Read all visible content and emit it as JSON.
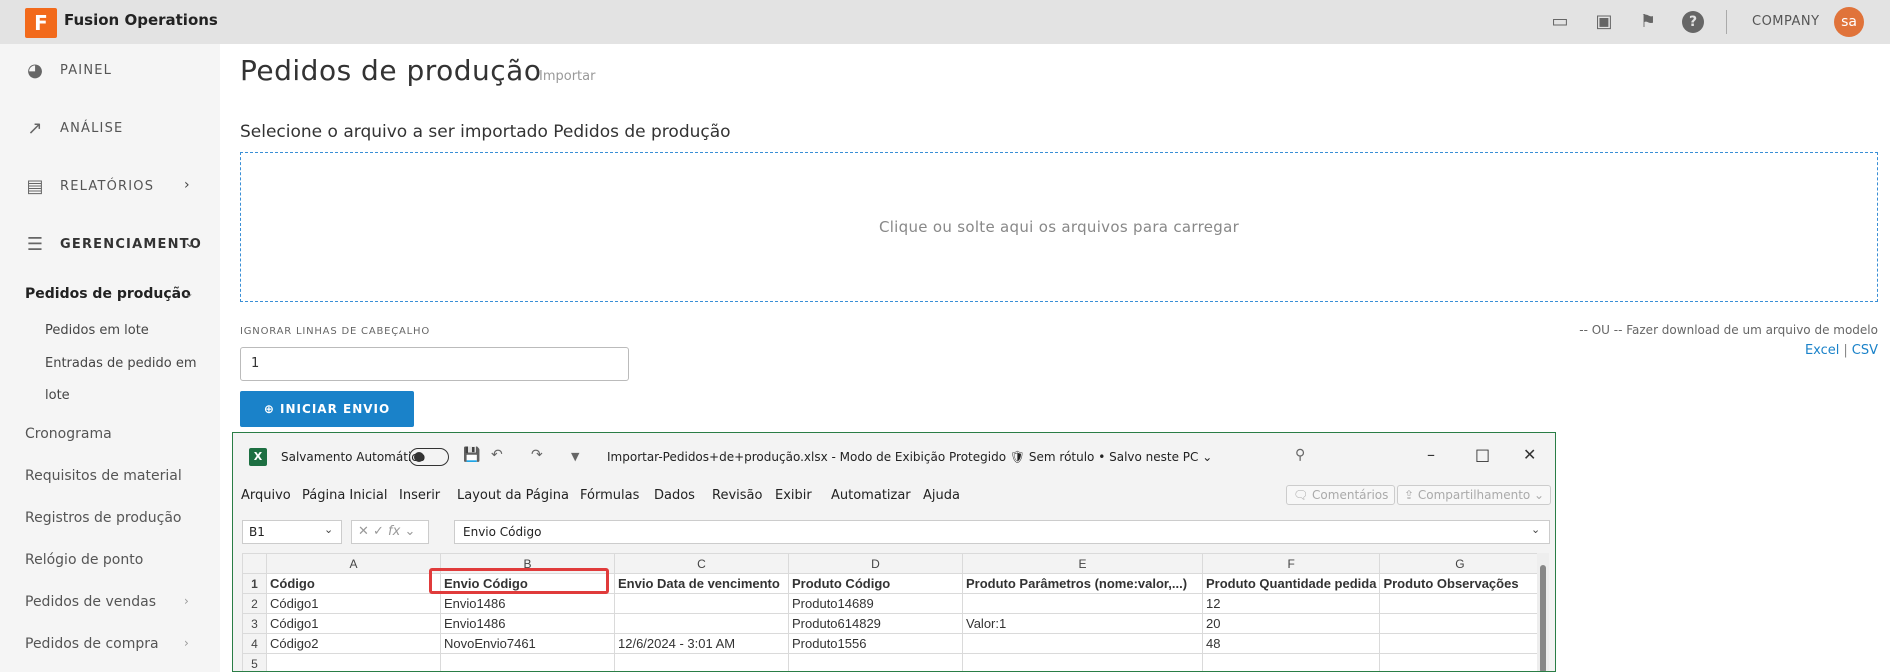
{
  "app": {
    "logo_letter": "F",
    "title": "Fusion Operations",
    "company": "COMPANY",
    "avatar": "sa"
  },
  "topbar_icons": [
    "chat-icon",
    "video-icon",
    "bookmark-icon",
    "help-icon"
  ],
  "sidebar": {
    "main": [
      {
        "label": "PAINEL",
        "icon": "gauge-icon"
      },
      {
        "label": "ANÁLISE",
        "icon": "analytics-icon"
      },
      {
        "label": "RELATÓRIOS",
        "icon": "reports-icon",
        "chevron": "›"
      },
      {
        "label": "GERENCIAMENTO",
        "icon": "sliders-icon",
        "chevron": "⌄"
      }
    ],
    "active": "Pedidos de produção",
    "active_chevron": "⌄",
    "sub": [
      "Pedidos em lote",
      "Entradas de pedido em",
      "lote"
    ],
    "sections": [
      {
        "label": "Cronograma"
      },
      {
        "label": "Requisitos de material"
      },
      {
        "label": "Registros de produção"
      },
      {
        "label": "Relógio de ponto"
      },
      {
        "label": "Pedidos de vendas",
        "chevron": "›"
      },
      {
        "label": "Pedidos de compra",
        "chevron": "›"
      }
    ]
  },
  "main": {
    "title": "Pedidos de produção",
    "subtitle": "Importar",
    "select_label": "Selecione o arquivo a ser importado Pedidos de produção",
    "dropzone_text": "Clique ou solte aqui os arquivos para carregar",
    "ignore_label": "IGNORAR LINHAS DE CABEÇALHO",
    "ignore_value": "1",
    "template_text": "-- OU -- Fazer download de um arquivo de modelo",
    "template_excel": "Excel",
    "template_sep": "|",
    "template_csv": "CSV",
    "start_button": "⊕ INICIAR ENVIO"
  },
  "excel": {
    "autosave_label": "Salvamento Automático",
    "file_info": "Importar-Pedidos+de+produção.xlsx  -  Modo de Exibição Protegido   🛡 Sem rótulo  •  Salvo neste PC ⌄",
    "menu": [
      "Arquivo",
      "Página Inicial",
      "Inserir",
      "Layout da Página",
      "Fórmulas",
      "Dados",
      "Revisão",
      "Exibir",
      "Automatizar",
      "Ajuda"
    ],
    "comments": "🗨 Comentários",
    "share": "⇪ Compartilhamento ⌄",
    "name_box": "B1",
    "fx": "✕ ✓ fx ⌄",
    "formula": "Envio Código",
    "columns": [
      "",
      "A",
      "B",
      "C",
      "D",
      "E",
      "F",
      "G"
    ],
    "rows": [
      [
        "1",
        "Código",
        "Envio Código",
        "Envio Data de vencimento",
        "Produto Código",
        "Produto Parâmetros (nome:valor,...)",
        "Produto Quantidade pedida",
        "Produto Observações"
      ],
      [
        "2",
        "Código1",
        "Envio1486",
        "",
        "Produto14689",
        "",
        "12",
        ""
      ],
      [
        "3",
        "Código1",
        "Envio1486",
        "",
        "Produto614829",
        "Valor:1",
        "20",
        ""
      ],
      [
        "4",
        "Código2",
        "NovoEnvio7461",
        "12/6/2024 - 3:01 AM",
        "Produto1556",
        "",
        "48",
        ""
      ],
      [
        "5",
        "",
        "",
        "",
        "",
        "",
        "",
        ""
      ]
    ]
  }
}
